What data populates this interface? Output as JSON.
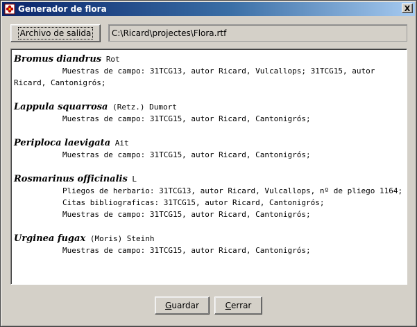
{
  "window": {
    "title": "Generador de flora",
    "close_glyph": "X",
    "icon": "app-flower-icon"
  },
  "output": {
    "button_label": "Archivo de salida",
    "path": "C:\\Ricard\\projectes\\Flora.rtf"
  },
  "entries": [
    {
      "name": "Bromus diandrus",
      "author": "Rot",
      "lines": [
        "Muestras de campo: 31TCG13, autor Ricard, Vulcallops; 31TCG15, autor Ricard, Cantonigrós;"
      ]
    },
    {
      "name": "Lappula squarrosa",
      "author": "(Retz.) Dumort",
      "lines": [
        "Muestras de campo: 31TCG15, autor Ricard, Cantonigrós;"
      ]
    },
    {
      "name": "Periploca laevigata",
      "author": "Ait",
      "lines": [
        "Muestras de campo: 31TCG15, autor Ricard, Cantonigrós;"
      ]
    },
    {
      "name": "Rosmarinus officinalis",
      "author": "L",
      "lines": [
        "Pliegos de herbario: 31TCG13, autor Ricard, Vulcallops, nº de pliego 1164;",
        "Citas bibliograficas: 31TCG15, autor Ricard, Cantonigrós;",
        "Muestras de campo: 31TCG15, autor Ricard, Cantonigrós;"
      ]
    },
    {
      "name": "Urginea fugax",
      "author": "(Moris) Steinh",
      "lines": [
        "Muestras de campo: 31TCG15, autor Ricard, Cantonigrós;"
      ]
    }
  ],
  "footer": {
    "save_mnemonic": "G",
    "save_rest": "uardar",
    "close_mnemonic": "C",
    "close_rest": "errar"
  }
}
